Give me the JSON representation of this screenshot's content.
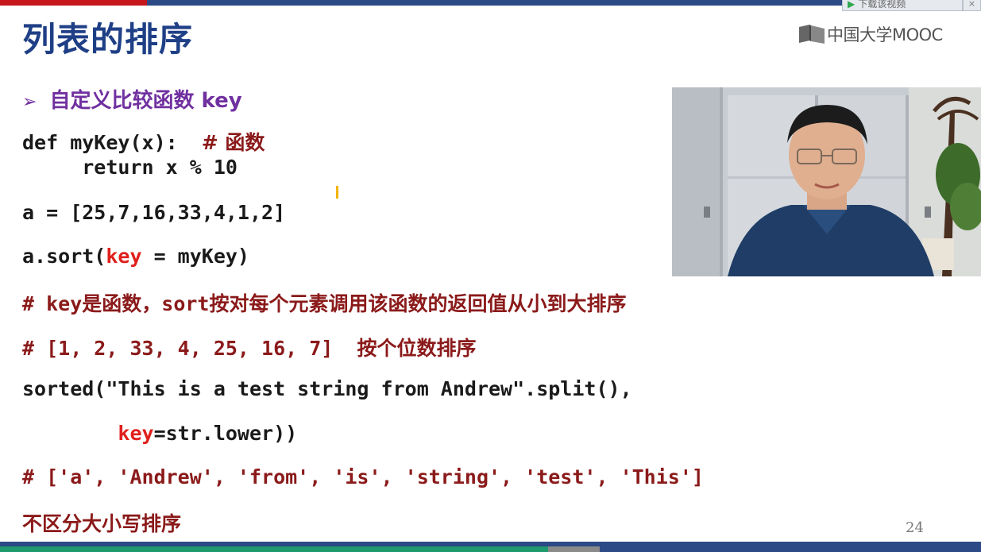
{
  "slide": {
    "title": "列表的排序",
    "page_number": "24"
  },
  "logo": {
    "text": "中国大学MOOC"
  },
  "download_button": {
    "label": "下载该视频",
    "close": "×"
  },
  "bullet": {
    "text": "自定义比较函数 key"
  },
  "code": {
    "line1_a": "def myKey(x):  ",
    "line1_comment": "# 函数",
    "line2": "     return x % 10",
    "line3": "a = [25,7,16,33,4,1,2]",
    "line4_a": "a.sort(",
    "line4_kw": "key",
    "line4_b": " = myKey)",
    "line5_a": "# key",
    "line5_b": "是函数，",
    "line5_c": "sort",
    "line5_d": "按对每个元素调用该函数的返回值从小到大排序",
    "line6_a": "# [1, 2, 33, 4, 25, 16, 7]  ",
    "line6_b": "按个位数排序",
    "line7": "sorted(\"This is a test string from Andrew\".split(),",
    "line8_kw": "key",
    "line8_b": "=str.lower))",
    "line9": "# ['a', 'Andrew', 'from', 'is', 'string', 'test', 'This']",
    "line10": "不区分大小写排序"
  },
  "colors": {
    "title": "#1f3f86",
    "bullet": "#7030a0",
    "keyword": "#e0201c",
    "comment": "#8b1a1a"
  }
}
